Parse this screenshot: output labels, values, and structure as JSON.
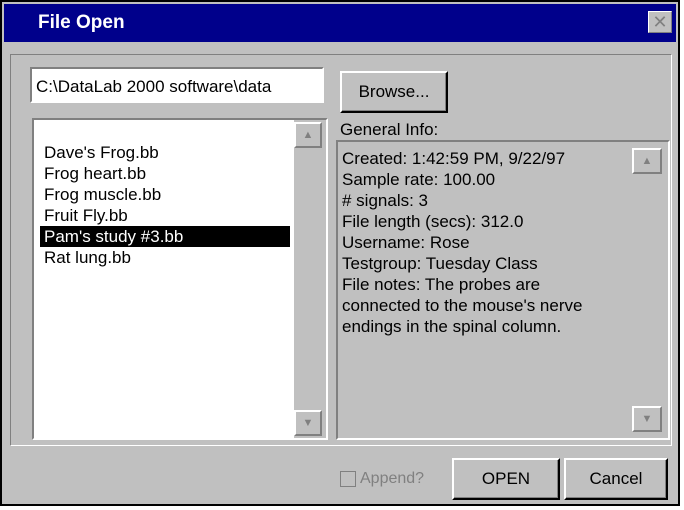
{
  "window": {
    "title": "File Open",
    "close_glyph": "✕"
  },
  "path": {
    "value": "C:\\DataLab 2000 software\\data"
  },
  "buttons": {
    "browse": "Browse...",
    "open": "OPEN",
    "cancel": "Cancel"
  },
  "files": {
    "items": [
      "Dave's Frog.bb",
      "Frog heart.bb",
      "Frog muscle.bb",
      "Fruit Fly.bb",
      "Pam's study #3.bb",
      "Rat lung.bb"
    ],
    "selected": "Pam's study #3.bb"
  },
  "info": {
    "label": "General Info:",
    "lines": [
      "Created: 1:42:59 PM, 9/22/97",
      "Sample rate: 100.00",
      "# signals: 3",
      "File length (secs): 312.0",
      "Username: Rose",
      "Testgroup: Tuesday Class",
      "File notes: The probes are",
      "connected to the mouse's nerve",
      "endings in the spinal column."
    ]
  },
  "append": {
    "label": "Append?",
    "checked": false,
    "disabled": true
  },
  "colors": {
    "titlebar": "#00008b",
    "selection": "#000000",
    "face": "#c0c0c0"
  },
  "icons": [
    "close-icon",
    "scroll-up-arrow-icon",
    "scroll-down-arrow-icon"
  ]
}
